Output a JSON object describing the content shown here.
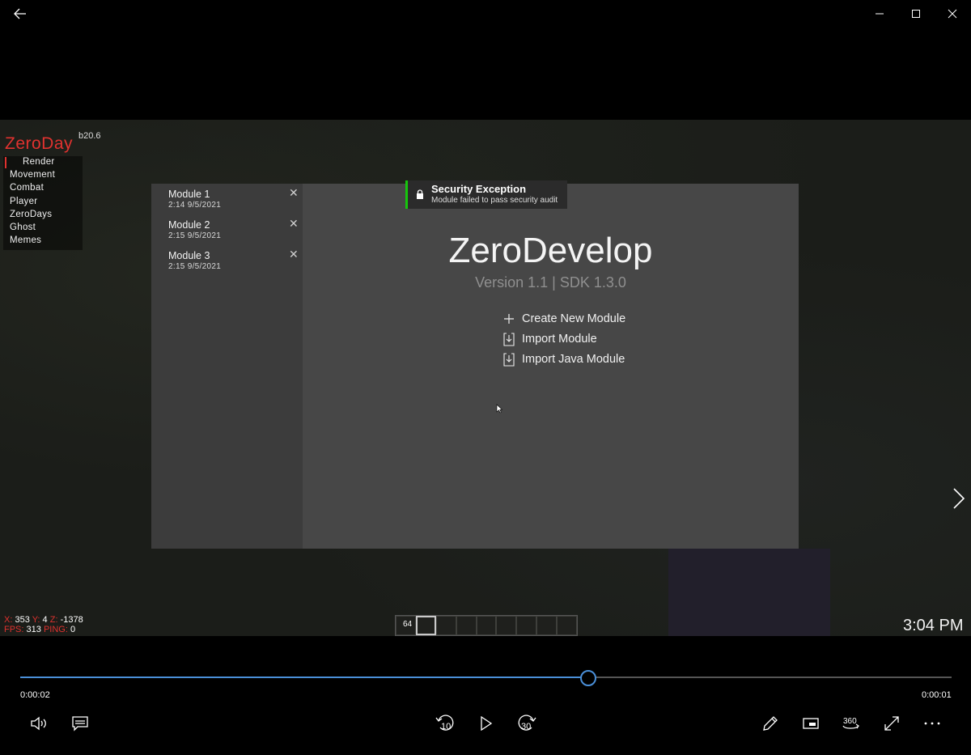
{
  "window": {
    "back": "back-arrow",
    "minimize": "minimize",
    "maximize": "maximize",
    "close": "close"
  },
  "client": {
    "name": "ZeroDay",
    "version": "b20.6",
    "menu": [
      "Render",
      "Movement",
      "Combat",
      "Player",
      "ZeroDays",
      "Ghost",
      "Memes"
    ],
    "accent": "#e0322f"
  },
  "hud": {
    "x_label": "X:",
    "x": "353",
    "y_label": "Y:",
    "y": "4",
    "z_label": "Z:",
    "z": "-1378",
    "fps_label": "FPS:",
    "fps": "313",
    "ping_label": "PING:",
    "ping": "0",
    "hotbar_count": "64",
    "clock": "3:04 PM"
  },
  "dialog": {
    "modules": [
      {
        "name": "Module 1",
        "time": "2:14  9/5/2021"
      },
      {
        "name": "Module 2",
        "time": "2:15  9/5/2021"
      },
      {
        "name": "Module 3",
        "time": "2:15  9/5/2021"
      }
    ],
    "title": "ZeroDevelop",
    "version": "Version 1.1  |  SDK 1.3.0",
    "actions": [
      "Create New Module",
      "Import Module",
      "Import Java Module"
    ]
  },
  "toast": {
    "title": "Security Exception",
    "message": "Module failed to pass security audit",
    "accent": "#16c60c"
  },
  "player": {
    "elapsed": "0:00:02",
    "remaining": "0:00:01",
    "progress": 0.61,
    "skip_back": "10",
    "skip_forward": "30",
    "accent": "#4a8fd8"
  }
}
